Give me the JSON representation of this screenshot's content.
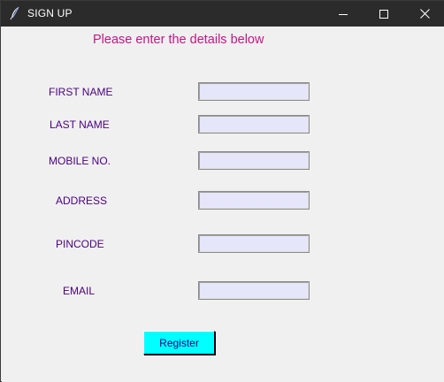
{
  "window": {
    "title": "SIGN UP",
    "icon": "feather-icon",
    "controls": [
      "minimize-icon",
      "maximize-icon",
      "close-icon"
    ]
  },
  "form": {
    "heading": "Please enter the details below",
    "fields": [
      {
        "label": "FIRST NAME",
        "value": ""
      },
      {
        "label": "LAST NAME",
        "value": ""
      },
      {
        "label": "MOBILE NO.",
        "value": ""
      },
      {
        "label": "ADDRESS",
        "value": ""
      },
      {
        "label": "PINCODE",
        "value": ""
      },
      {
        "label": "EMAIL",
        "value": ""
      }
    ],
    "register_label": "Register"
  },
  "colors": {
    "heading": "#c71585",
    "labels": "#4b0082",
    "field_bg": "#e6e6fa",
    "button_bg": "#00ffff",
    "button_text": "#000080",
    "titlebar": "#2b2b2b"
  }
}
